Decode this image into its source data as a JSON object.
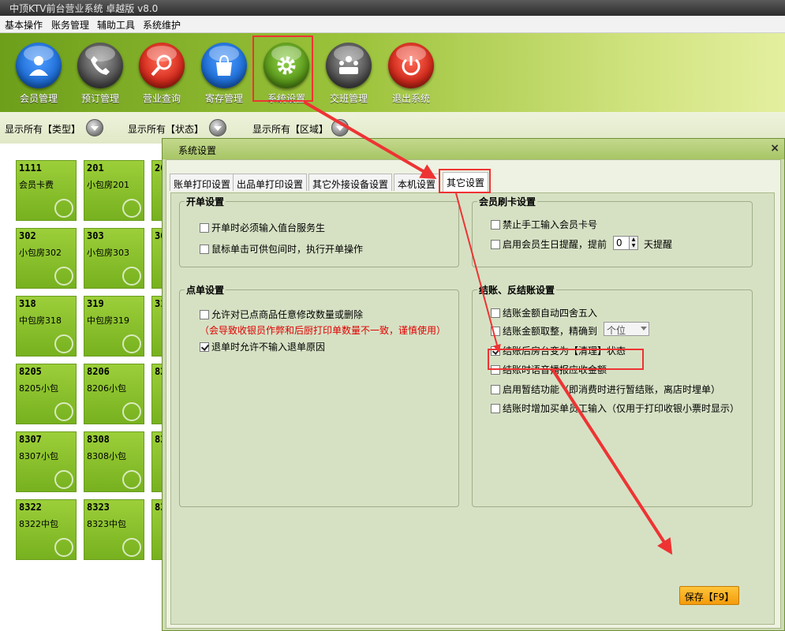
{
  "window": {
    "title": "中顶KTV前台营业系统 卓越版 v8.0"
  },
  "menu": [
    "基本操作",
    "账务管理",
    "辅助工具",
    "系统维护"
  ],
  "toolbar": [
    {
      "label": "会员管理",
      "icon": "member-icon",
      "color": "#1e6fd8"
    },
    {
      "label": "预订管理",
      "icon": "phone-icon",
      "color": "#4f4f4f"
    },
    {
      "label": "营业查询",
      "icon": "search-icon",
      "color": "#d42a1c"
    },
    {
      "label": "寄存管理",
      "icon": "bag-icon",
      "color": "#1e6fd8"
    },
    {
      "label": "系统设置",
      "icon": "gear-icon",
      "color": "#5b9a1a"
    },
    {
      "label": "交班管理",
      "icon": "meeting-icon",
      "color": "#4f4f4f"
    },
    {
      "label": "退出系统",
      "icon": "power-icon",
      "color": "#d42a1c"
    }
  ],
  "filters": [
    "显示所有【类型】",
    "显示所有【状态】",
    "显示所有【区域】"
  ],
  "rooms": [
    {
      "num": "1111",
      "name": "会员卡费"
    },
    {
      "num": "201",
      "name": "小包房201"
    },
    {
      "num": "302",
      "name": "小包房302"
    },
    {
      "num": "303",
      "name": "小包房303"
    },
    {
      "num": "318",
      "name": "中包房318"
    },
    {
      "num": "319",
      "name": "中包房319"
    },
    {
      "num": "8205",
      "name": "8205小包"
    },
    {
      "num": "8206",
      "name": "8206小包"
    },
    {
      "num": "8307",
      "name": "8307小包"
    },
    {
      "num": "8308",
      "name": "8308小包"
    },
    {
      "num": "8322",
      "name": "8322中包"
    },
    {
      "num": "8323",
      "name": "8323中包"
    }
  ],
  "room_partial": [
    "20",
    "30",
    "31",
    "82",
    "83",
    "83"
  ],
  "dialog": {
    "title": "系统设置",
    "close": "×",
    "tabs": [
      "账单打印设置",
      "出品单打印设置",
      "其它外接设备设置",
      "本机设置",
      "其它设置"
    ],
    "open_group": {
      "title": "开单设置",
      "items": [
        {
          "label": "开单时必须输入值台服务生",
          "checked": false
        },
        {
          "label": "鼠标单击可供包间时，执行开单操作",
          "checked": false
        }
      ]
    },
    "order_group": {
      "title": "点单设置",
      "items": [
        {
          "label": "允许对已点商品任意修改数量或删除",
          "checked": false
        },
        {
          "label": "退单时允许不输入退单原因",
          "checked": true
        }
      ],
      "warning": "（会导致收银员作弊和后厨打印单数量不一致，谨慎使用）"
    },
    "card_group": {
      "title": "会员刷卡设置",
      "items": [
        {
          "label": "禁止手工输入会员卡号",
          "checked": false
        },
        {
          "label": "启用会员生日提醒，提前",
          "checked": false
        }
      ],
      "spin_value": "0",
      "spin_suffix": "天提醒"
    },
    "checkout_group": {
      "title": "结账、反结账设置",
      "items": [
        {
          "label": "结账金额自动四舍五入",
          "checked": false
        },
        {
          "label": "结账金额取整，精确到",
          "checked": false
        },
        {
          "label": "结账后房台变为【清理】状态",
          "checked": true
        },
        {
          "label": "结账时语音播报应收金额",
          "checked": false
        },
        {
          "label": "启用暂结功能（即消费时进行暂结账，离店时埋单）",
          "checked": false
        },
        {
          "label": "结账时增加买单员工输入（仅用于打印收银小票时显示）",
          "checked": false
        }
      ],
      "precision": "个位"
    },
    "save_label": "保存【F9】"
  },
  "colors": {
    "highlight": "#ee3333",
    "save": "#f39c0c",
    "room": "#8cc430"
  }
}
